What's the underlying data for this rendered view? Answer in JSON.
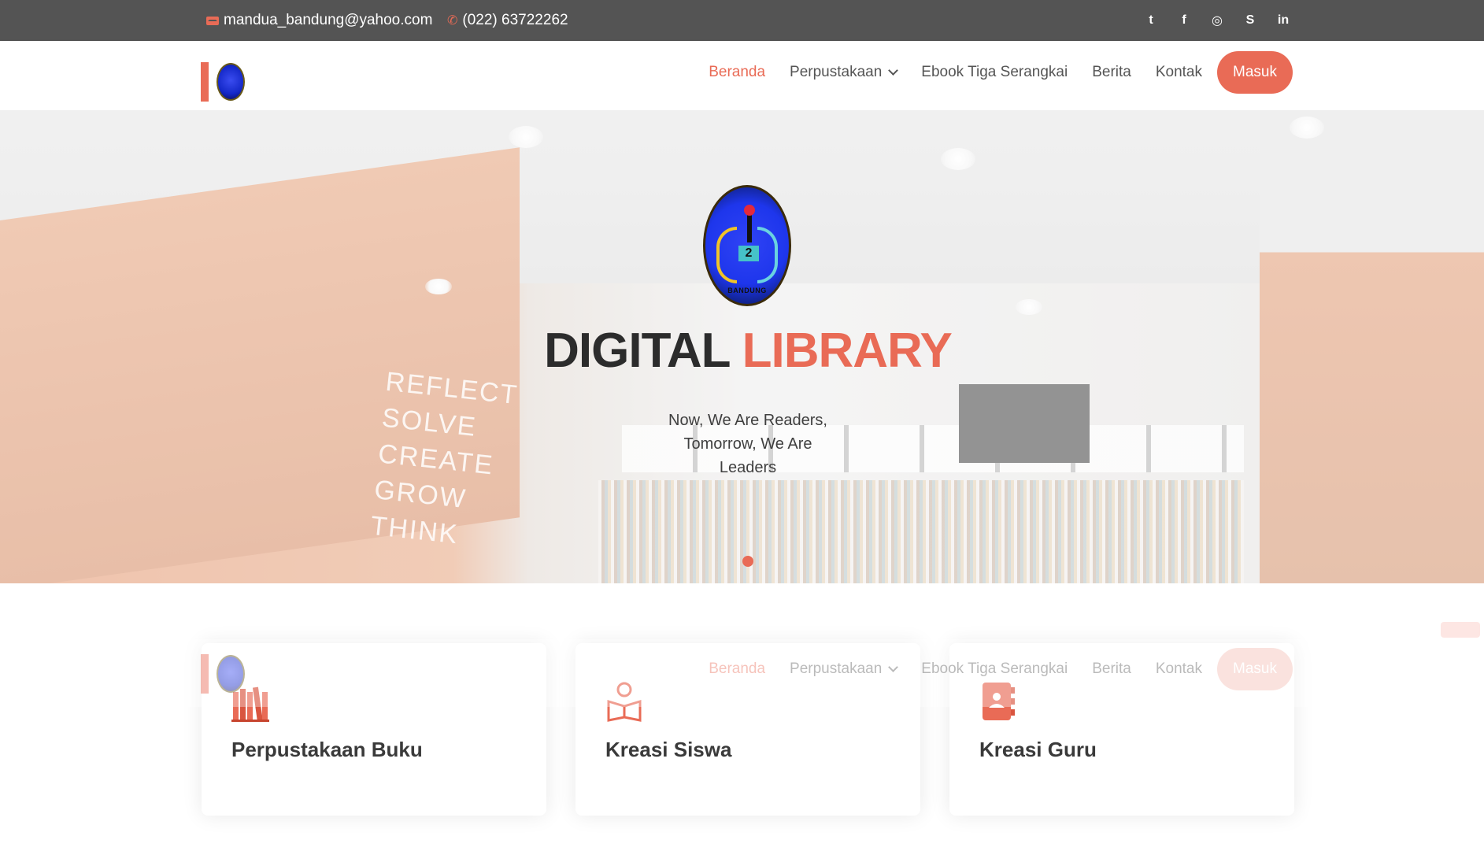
{
  "topbar": {
    "email": "mandua_bandung@yahoo.com",
    "phone": "(022) 63722262",
    "socials": [
      {
        "name": "twitter-icon",
        "glyph": "t"
      },
      {
        "name": "facebook-icon",
        "glyph": "f"
      },
      {
        "name": "instagram-icon",
        "glyph": "◎"
      },
      {
        "name": "skype-icon",
        "glyph": "S"
      },
      {
        "name": "linkedin-icon",
        "glyph": "in"
      }
    ]
  },
  "nav": {
    "items": [
      {
        "label": "Beranda",
        "active": true
      },
      {
        "label": "Perpustakaan",
        "dropdown": true
      },
      {
        "label": "Ebook Tiga Serangkai"
      },
      {
        "label": "Berita"
      },
      {
        "label": "Kontak"
      }
    ],
    "login": "Masuk"
  },
  "hero": {
    "crest_number": "2",
    "crest_city": "BANDUNG",
    "title_main": "DIGITAL",
    "title_accent": "LIBRARY",
    "tagline": "Now, We Are Readers, Tomorrow, We Are Leaders",
    "wall_text": [
      "REFLECT",
      "SOLVE",
      "CREATE",
      "GROW",
      "THINK"
    ]
  },
  "cards": [
    {
      "label": "Perpustakaan Buku",
      "icon": "books-icon"
    },
    {
      "label": "Kreasi Siswa",
      "icon": "reading-student-icon"
    },
    {
      "label": "Kreasi Guru",
      "icon": "teacher-book-icon"
    }
  ],
  "colors": {
    "accent": "#e96b56",
    "topbar": "#545454"
  }
}
